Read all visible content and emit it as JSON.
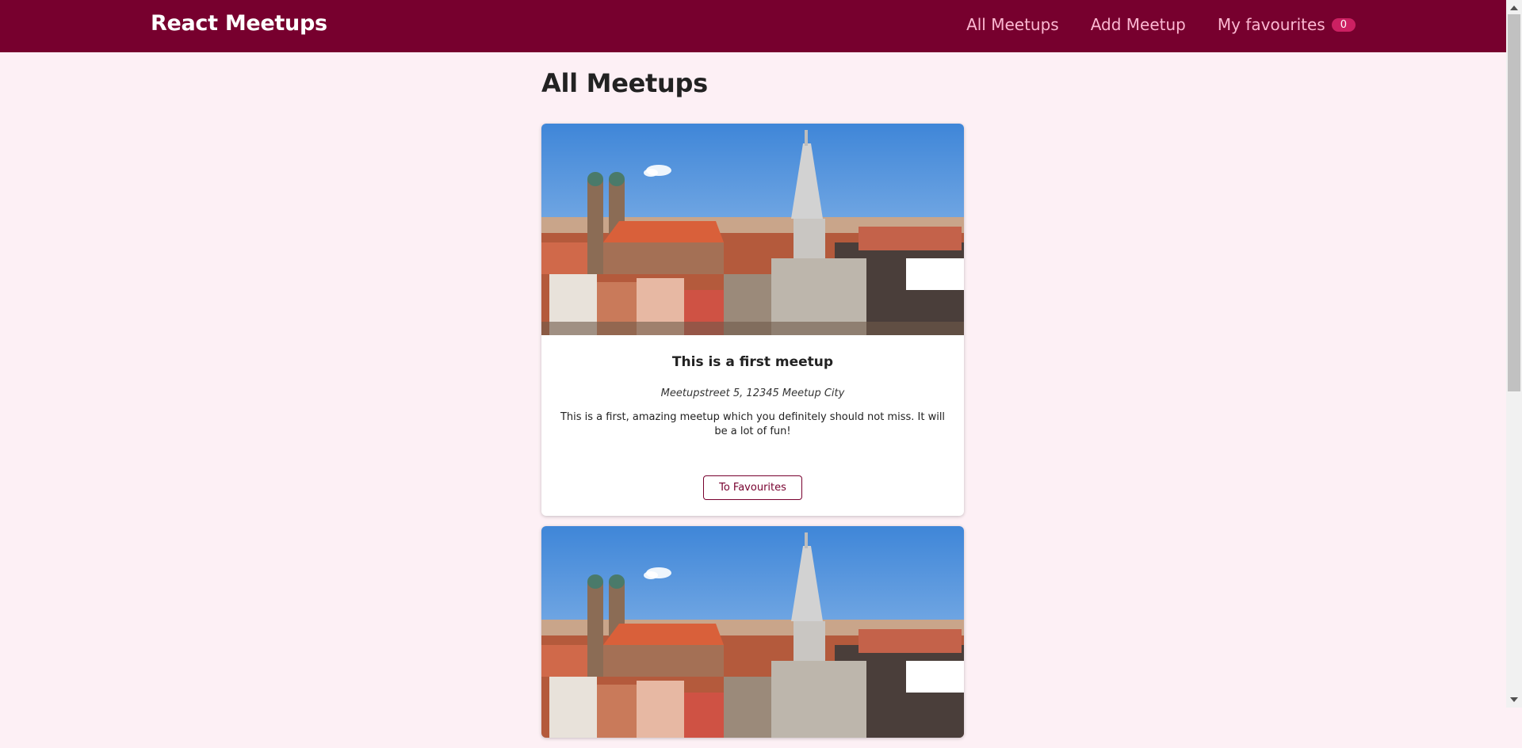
{
  "header": {
    "logo": "React Meetups",
    "nav": {
      "all_meetups": "All Meetups",
      "add_meetup": "Add Meetup",
      "my_favourites": "My favourites",
      "favourites_count": "0"
    }
  },
  "main": {
    "title": "All Meetups",
    "meetups": [
      {
        "title": "This is a first meetup",
        "address": "Meetupstreet 5, 12345 Meetup City",
        "description": "This is a first, amazing meetup which you definitely should not miss. It will be a lot of fun!",
        "button_label": "To Favourites"
      },
      {
        "title": "",
        "address": "",
        "description": "",
        "button_label": ""
      }
    ]
  },
  "colors": {
    "header_bg": "#77002e",
    "nav_text": "#fcb8d2",
    "badge_bg": "#cc2062",
    "page_bg": "#fdf0f5"
  }
}
